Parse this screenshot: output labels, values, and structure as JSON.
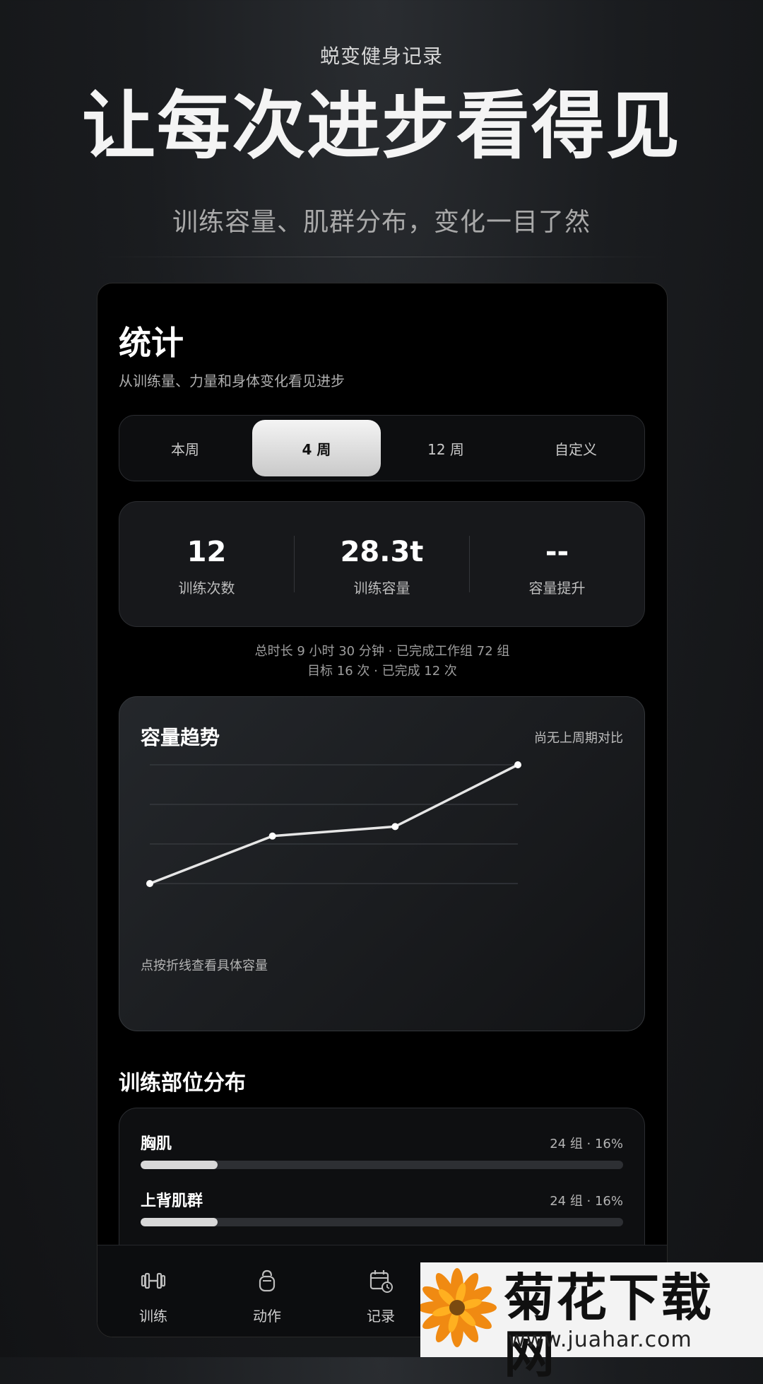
{
  "hero": {
    "brand": "蜕变健身记录",
    "headline": "让每次进步看得见",
    "tagline": "训练容量、肌群分布，变化一目了然"
  },
  "stats_page": {
    "title": "统计",
    "subtitle": "从训练量、力量和身体变化看见进步",
    "periods": [
      "本周",
      "4 周",
      "12 周",
      "自定义"
    ],
    "active_period": "4 周",
    "metrics": [
      {
        "value": "12",
        "label": "训练次数"
      },
      {
        "value": "28.3t",
        "label": "训练容量"
      },
      {
        "value": "--",
        "label": "容量提升"
      }
    ],
    "summary_line1": "总时长 9 小时 30 分钟 · 已完成工作组 72 组",
    "summary_line2": "目标 16 次 · 已完成 12 次"
  },
  "trend_card": {
    "title": "容量趋势",
    "comparison_note": "尚无上周期对比",
    "hint": "点按折线查看具体容量"
  },
  "chart_data": {
    "type": "line",
    "title": "容量趋势",
    "xlabel": "",
    "ylabel": "",
    "x": [
      1,
      2,
      3,
      4
    ],
    "values": [
      0.0,
      0.4,
      0.48,
      1.0
    ],
    "grid": true,
    "ylim": [
      0,
      1
    ]
  },
  "distribution": {
    "title": "训练部位分布",
    "items": [
      {
        "name": "胸肌",
        "meta": "24 组 · 16%",
        "percent": 16
      },
      {
        "name": "上背肌群",
        "meta": "24 组 · 16%",
        "percent": 16
      }
    ]
  },
  "tabbar": {
    "items": [
      {
        "label": "训练",
        "icon": "dumbbell-icon"
      },
      {
        "label": "动作",
        "icon": "kettlebell-icon"
      },
      {
        "label": "记录",
        "icon": "calendar-clock-icon"
      }
    ]
  },
  "watermark": {
    "text": "菊花下载网",
    "url": "www.juahar.com"
  },
  "colors": {
    "background": "#16181b",
    "card": "#17181b",
    "accent": "#e6e6e6"
  }
}
